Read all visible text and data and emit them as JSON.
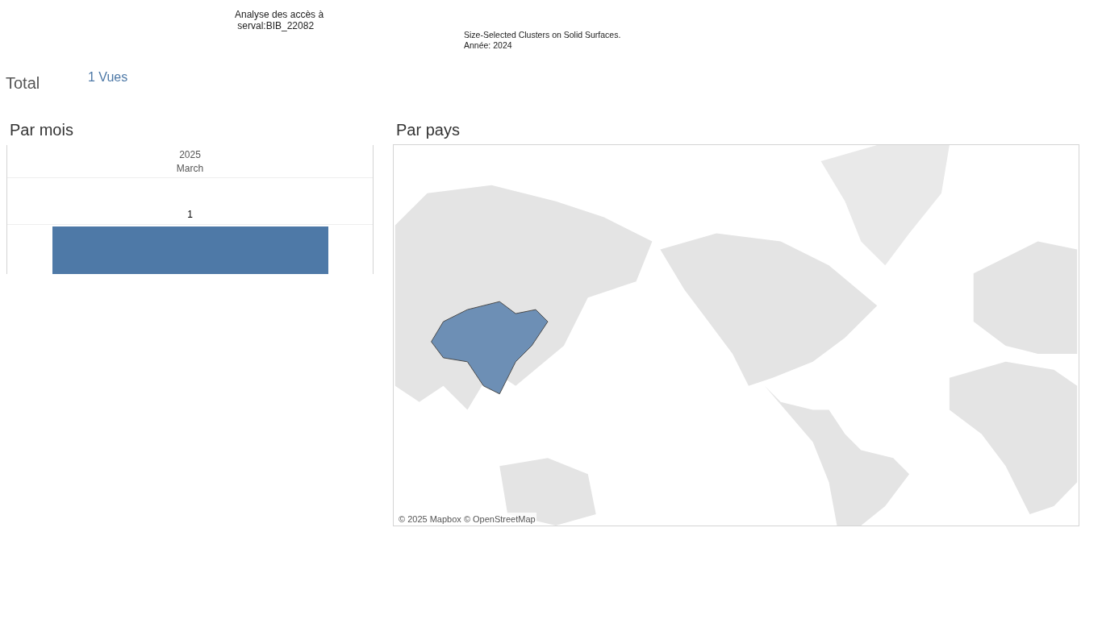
{
  "header": {
    "title_lines": [
      "Analyse des accès à",
      " serval:BIB_22082"
    ],
    "subtitle_lines": [
      "Size-Selected Clusters on Solid Surfaces.",
      "Année: 2024"
    ]
  },
  "total": {
    "label": "Total",
    "value": "1 Vues"
  },
  "by_month": {
    "title": "Par mois",
    "year_header": "2025",
    "months": [
      {
        "label": "March",
        "value": "1"
      }
    ]
  },
  "by_country": {
    "title": "Par pays",
    "attribution": "© 2025 Mapbox © OpenStreetMap"
  }
}
